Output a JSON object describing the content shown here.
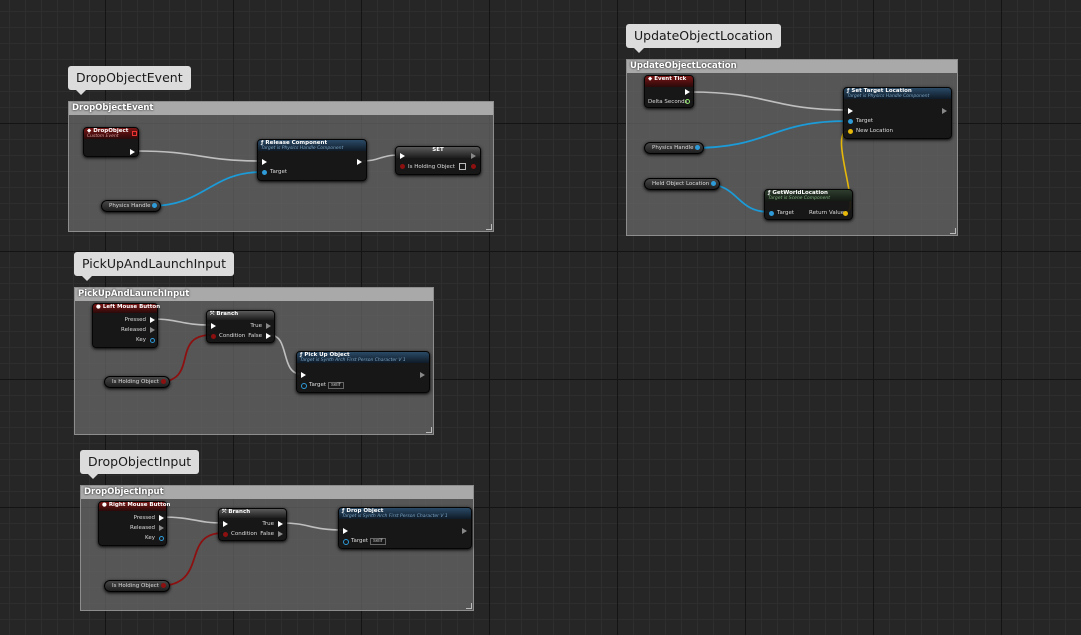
{
  "colors": {
    "exec_wire": "#bfbfbf",
    "object_wire": "#1b9bd8",
    "bool_wire": "#8c1010",
    "vector_wire": "#e6b80a"
  },
  "groups": {
    "drop_object_event": {
      "bubble": "DropObjectEvent",
      "title": "DropObjectEvent",
      "event_node": {
        "title": "DropObject",
        "subtitle": "Custom Event"
      },
      "release_node": {
        "title": "Release Component",
        "subtitle": "Target is Physics Handle Component",
        "pin_target": "Target"
      },
      "set_node": {
        "title": "SET",
        "pin_var": "Is Holding Object"
      },
      "physics_var": "Physics Handle"
    },
    "update_object_location": {
      "bubble": "UpdateObjectLocation",
      "title": "UpdateObjectLocation",
      "tick_node": {
        "title": "Event Tick",
        "pin_delta": "Delta Seconds"
      },
      "set_target_node": {
        "title": "Set Target Location",
        "subtitle": "Target is Physics Handle Component",
        "pin_target": "Target",
        "pin_new_location": "New Location"
      },
      "physics_var": "Physics Handle",
      "held_var": "Held Object Location",
      "get_world_node": {
        "title": "GetWorldLocation",
        "subtitle": "Target is Scene Component",
        "pin_target": "Target",
        "pin_return": "Return Value"
      }
    },
    "pick_up_and_launch": {
      "bubble": "PickUpAndLaunchInput",
      "title": "PickUpAndLaunchInput",
      "mouse_node": {
        "title": "Left Mouse Button",
        "pin_pressed": "Pressed",
        "pin_released": "Released",
        "pin_key": "Key"
      },
      "branch_node": {
        "title": "Branch",
        "pin_condition": "Condition",
        "pin_true": "True",
        "pin_false": "False"
      },
      "holding_var": "Is Holding Object",
      "pickup_node": {
        "title": "Pick Up Object",
        "subtitle": "Target is Synth Arch First Person Character V 1",
        "pin_target": "Target",
        "self_label": "self"
      }
    },
    "drop_object_input": {
      "bubble": "DropObjectInput",
      "title": "DropObjectInput",
      "mouse_node": {
        "title": "Right Mouse Button",
        "pin_pressed": "Pressed",
        "pin_released": "Released",
        "pin_key": "Key"
      },
      "branch_node": {
        "title": "Branch",
        "pin_condition": "Condition",
        "pin_true": "True",
        "pin_false": "False"
      },
      "holding_var": "Is Holding Object",
      "drop_node": {
        "title": "Drop Object",
        "subtitle": "Target is Synth Arch First Person Character V 1",
        "pin_target": "Target",
        "self_label": "self"
      }
    }
  }
}
